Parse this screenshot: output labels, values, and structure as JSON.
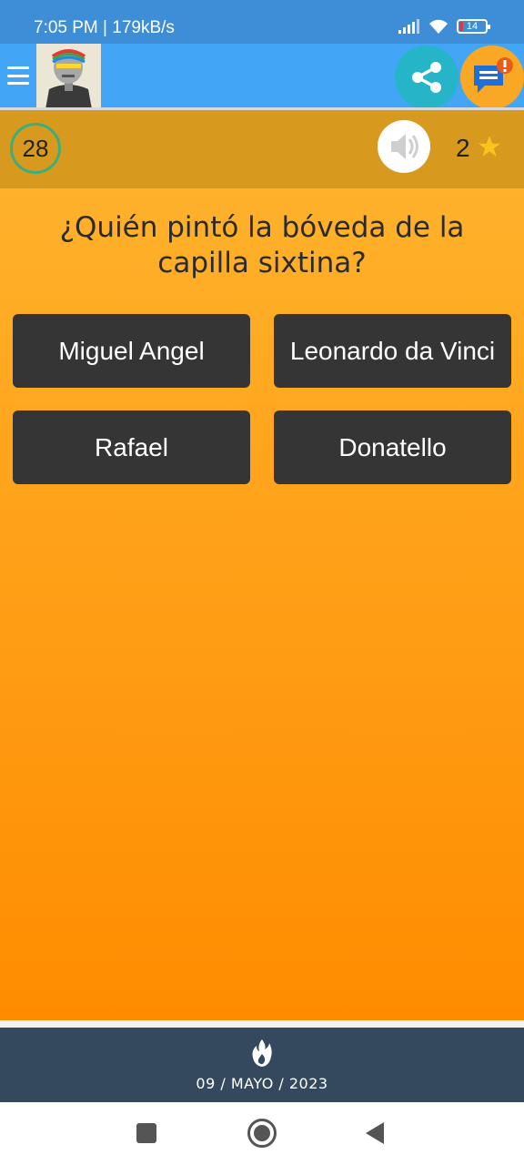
{
  "status_bar": {
    "time_speed": "7:05 PM | 179kB/s",
    "battery": "14"
  },
  "app_bar": {
    "menu_icon": "hamburger-menu-icon",
    "avatar_icon": "robot-avatar",
    "share_icon": "share-icon",
    "chat_icon": "chat-notification-icon"
  },
  "score": {
    "timer": "28",
    "stars": "2",
    "sound_icon": "speaker-icon",
    "star_icon": "star-icon"
  },
  "quiz": {
    "question": "¿Quién pintó la bóveda de la capilla sixtina?",
    "answers": [
      "Miguel Angel",
      "Leonardo da Vinci",
      "Rafael",
      "Donatello"
    ]
  },
  "footer": {
    "date": "09 / MAYO / 2023",
    "flame_icon": "flame-icon"
  },
  "colors": {
    "status_bar": "#3d8ed6",
    "app_bar": "#42a5f5",
    "score_bar": "#d79a1e",
    "background_top": "#ffb12b",
    "background_bottom": "#ff8c00",
    "answer_button": "#353535",
    "footer": "#34495e"
  }
}
